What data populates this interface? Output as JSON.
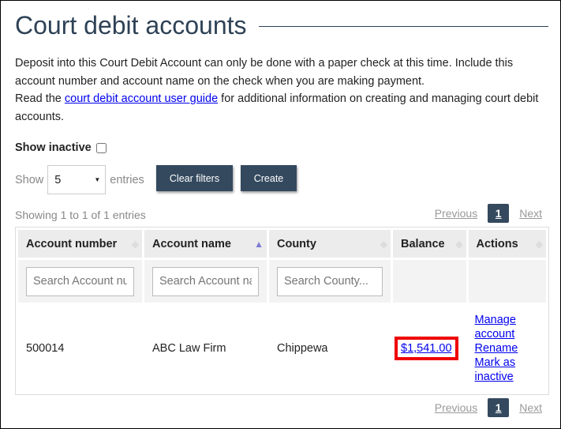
{
  "title": "Court debit accounts",
  "intro": {
    "text1": "Deposit into this Court Debit Account can only be done with a paper check at this time. Include this account number and account name on the check when you are making payment.",
    "text2_pre": "Read the ",
    "link": "court debit account user guide",
    "text2_post": " for additional information on creating and managing court debit accounts."
  },
  "show_inactive": {
    "label": "Show inactive",
    "checked": false
  },
  "length": {
    "show": "Show",
    "value": "5",
    "entries": "entries"
  },
  "buttons": {
    "clear": "Clear filters",
    "create": "Create"
  },
  "info": "Showing 1 to 1 of 1 entries",
  "pagination": {
    "previous": "Previous",
    "page": "1",
    "next": "Next"
  },
  "columns": [
    "Account number",
    "Account name",
    "County",
    "Balance",
    "Actions"
  ],
  "filters": [
    "Search Account number...",
    "Search Account name...",
    "Search County..."
  ],
  "rows": [
    {
      "account_number": "500014",
      "account_name": "ABC Law Firm",
      "county": "Chippewa",
      "balance": "$1,541.00",
      "actions": [
        "Manage account",
        "Rename",
        "Mark as inactive"
      ]
    }
  ]
}
